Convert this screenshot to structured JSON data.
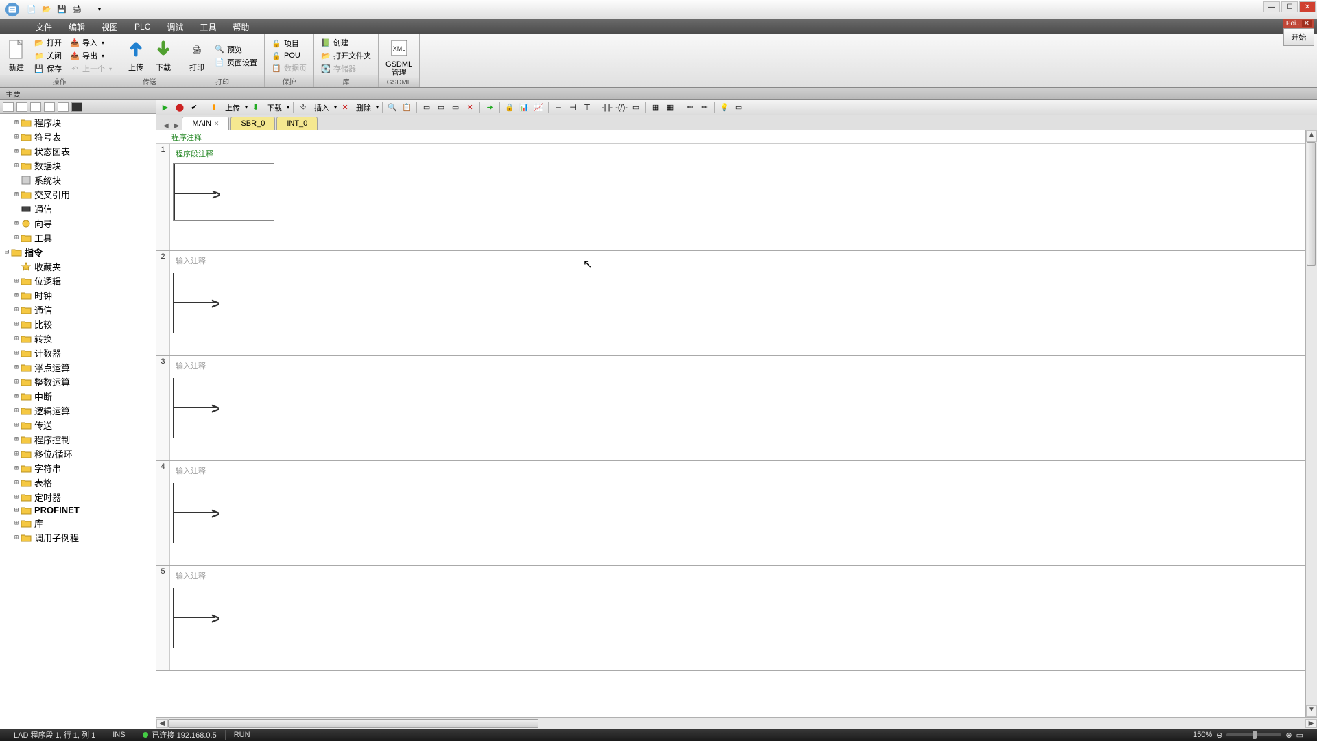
{
  "float": {
    "title": "Poi...",
    "btn": "开始"
  },
  "menu": [
    "文件",
    "编辑",
    "视图",
    "PLC",
    "调试",
    "工具",
    "帮助"
  ],
  "ribbon": {
    "g1": {
      "new": "新建",
      "open": "打开",
      "close": "关闭",
      "save": "保存",
      "import": "导入",
      "export": "导出",
      "prev": "上一个",
      "label": "操作"
    },
    "g2": {
      "up": "上传",
      "down": "下载",
      "label": "传送"
    },
    "g3": {
      "print": "打印",
      "preview": "预览",
      "page": "页面设置",
      "label": "打印"
    },
    "g4": {
      "proj": "项目",
      "pou": "POU",
      "data": "数据页",
      "label": "保护"
    },
    "g5": {
      "create": "创建",
      "openf": "打开文件夹",
      "mem": "存储器",
      "label": "库"
    },
    "g6": {
      "xml": "GSDML\n管理",
      "label": "GSDML"
    }
  },
  "sidebar_title": "主要",
  "tree": {
    "top": [
      {
        "t": "程序块",
        "exp": "+",
        "ic": "folder"
      },
      {
        "t": "符号表",
        "exp": "+",
        "ic": "folder"
      },
      {
        "t": "状态图表",
        "exp": "+",
        "ic": "folder"
      },
      {
        "t": "数据块",
        "exp": "+",
        "ic": "folder"
      },
      {
        "t": "系统块",
        "exp": "",
        "ic": "block"
      },
      {
        "t": "交叉引用",
        "exp": "+",
        "ic": "folder"
      },
      {
        "t": "通信",
        "exp": "",
        "ic": "comm"
      },
      {
        "t": "向导",
        "exp": "+",
        "ic": "wiz"
      },
      {
        "t": "工具",
        "exp": "+",
        "ic": "folder"
      }
    ],
    "inst_label": "指令",
    "inst": [
      {
        "t": "收藏夹",
        "exp": "",
        "ic": "fav"
      },
      {
        "t": "位逻辑",
        "exp": "+",
        "ic": "folder"
      },
      {
        "t": "时钟",
        "exp": "+",
        "ic": "folder"
      },
      {
        "t": "通信",
        "exp": "+",
        "ic": "folder"
      },
      {
        "t": "比较",
        "exp": "+",
        "ic": "folder"
      },
      {
        "t": "转换",
        "exp": "+",
        "ic": "folder"
      },
      {
        "t": "计数器",
        "exp": "+",
        "ic": "folder"
      },
      {
        "t": "浮点运算",
        "exp": "+",
        "ic": "folder"
      },
      {
        "t": "整数运算",
        "exp": "+",
        "ic": "folder"
      },
      {
        "t": "中断",
        "exp": "+",
        "ic": "folder"
      },
      {
        "t": "逻辑运算",
        "exp": "+",
        "ic": "folder"
      },
      {
        "t": "传送",
        "exp": "+",
        "ic": "folder"
      },
      {
        "t": "程序控制",
        "exp": "+",
        "ic": "folder"
      },
      {
        "t": "移位/循环",
        "exp": "+",
        "ic": "folder"
      },
      {
        "t": "字符串",
        "exp": "+",
        "ic": "folder"
      },
      {
        "t": "表格",
        "exp": "+",
        "ic": "folder"
      },
      {
        "t": "定时器",
        "exp": "+",
        "ic": "folder"
      },
      {
        "t": "PROFINET",
        "exp": "+",
        "ic": "folder",
        "bold": true
      },
      {
        "t": "库",
        "exp": "+",
        "ic": "folder"
      },
      {
        "t": "调用子例程",
        "exp": "+",
        "ic": "folder"
      }
    ]
  },
  "toolbar": {
    "upload": "上传",
    "download": "下载",
    "insert": "插入",
    "delete": "删除"
  },
  "tabs": [
    {
      "t": "MAIN",
      "active": true,
      "closable": true
    },
    {
      "t": "SBR_0",
      "yellow": true
    },
    {
      "t": "INT_0",
      "yellow": true
    }
  ],
  "prog_comment": "程序注释",
  "networks": [
    {
      "n": "1",
      "c": "程序段注释",
      "box": true
    },
    {
      "n": "2",
      "c": "输入注释",
      "box": false
    },
    {
      "n": "3",
      "c": "输入注释",
      "box": false
    },
    {
      "n": "4",
      "c": "输入注释",
      "box": false
    },
    {
      "n": "5",
      "c": "输入注释",
      "box": false
    }
  ],
  "status": {
    "pos": "LAD 程序段 1, 行 1, 列 1",
    "ins": "INS",
    "conn": "已连接 192.168.0.5",
    "run": "RUN",
    "zoom": "150%"
  }
}
